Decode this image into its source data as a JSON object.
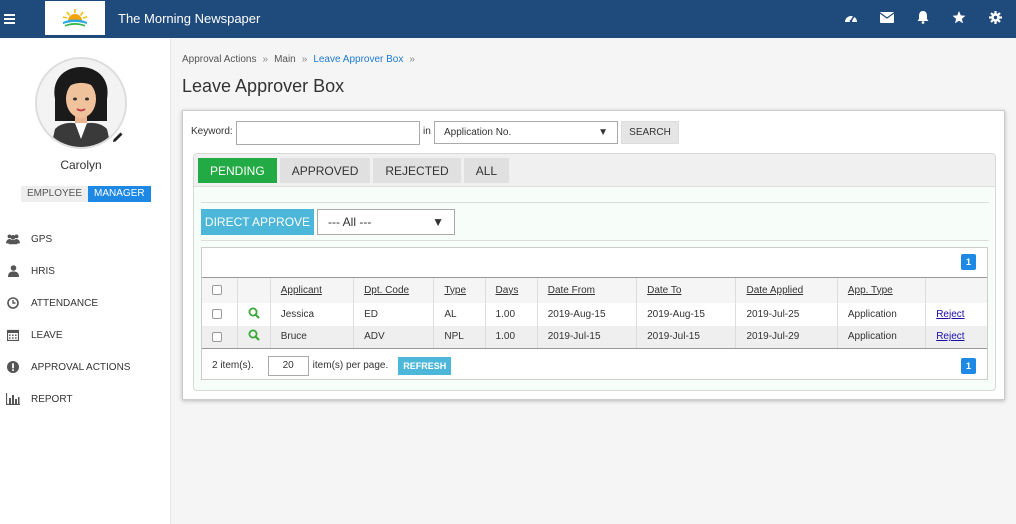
{
  "app": {
    "title": "The Morning Newspaper"
  },
  "top_icons": [
    "dashboard-icon",
    "envelope-icon",
    "bell-icon",
    "star-icon",
    "gear-icon"
  ],
  "user": {
    "name": "Carolyn",
    "roles": [
      "EMPLOYEE",
      "MANAGER"
    ],
    "active_role": "MANAGER"
  },
  "sidebar": {
    "items": [
      {
        "label": "GPS",
        "icon": "users-icon"
      },
      {
        "label": "HRIS",
        "icon": "user-icon"
      },
      {
        "label": "ATTENDANCE",
        "icon": "clock-icon"
      },
      {
        "label": "LEAVE",
        "icon": "calendar-icon"
      },
      {
        "label": "APPROVAL ACTIONS",
        "icon": "exclamation-icon"
      },
      {
        "label": "REPORT",
        "icon": "bar-chart-icon"
      }
    ]
  },
  "breadcrumb": [
    "Approval Actions",
    "Main",
    "Leave Approver Box"
  ],
  "page_title": "Leave Approver Box",
  "search": {
    "keyword_label": "Keyword:",
    "keyword_value": "",
    "in_label": "in",
    "field_selected": "Application No.",
    "button": "SEARCH"
  },
  "tabs": [
    {
      "label": "PENDING",
      "active": true
    },
    {
      "label": "APPROVED",
      "active": false
    },
    {
      "label": "REJECTED",
      "active": false
    },
    {
      "label": "ALL",
      "active": false
    }
  ],
  "actions": {
    "direct_approve": "DIRECT APPROVE",
    "filter_selected": "--- All ---"
  },
  "grid": {
    "page": "1",
    "columns": [
      "Applicant",
      "Dpt. Code",
      "Type",
      "Days",
      "Date From",
      "Date To",
      "Date Applied",
      "App. Type"
    ],
    "rows": [
      {
        "applicant": "Jessica",
        "dept": "ED",
        "type": "AL",
        "days": "1.00",
        "from": "2019-Aug-15",
        "to": "2019-Aug-15",
        "applied": "2019-Jul-25",
        "app_type": "Application",
        "action": "Reject"
      },
      {
        "applicant": "Bruce",
        "dept": "ADV",
        "type": "NPL",
        "days": "1.00",
        "from": "2019-Jul-15",
        "to": "2019-Jul-15",
        "applied": "2019-Jul-29",
        "app_type": "Application",
        "action": "Reject"
      }
    ],
    "footer": {
      "count": "2 item(s).",
      "per_page": "20",
      "per_page_label": "item(s) per page.",
      "refresh": "REFRESH"
    }
  },
  "colors": {
    "topbar": "#1f4a7c",
    "accent_blue": "#1e88e5",
    "active_tab": "#22aa44",
    "button_teal": "#4cb7d8"
  }
}
